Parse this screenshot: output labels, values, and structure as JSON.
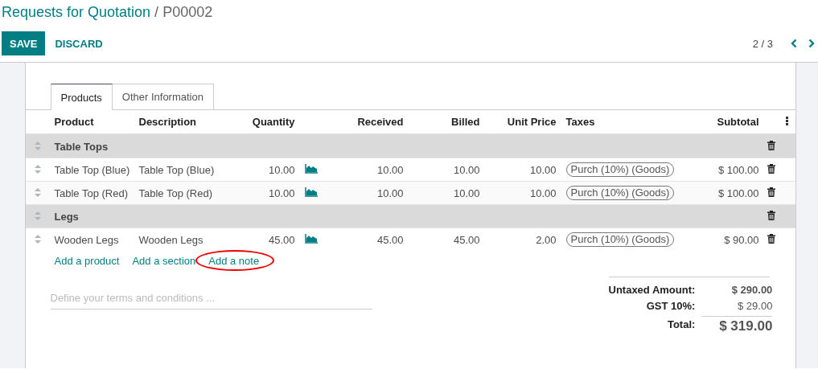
{
  "breadcrumb": {
    "parent": "Requests for Quotation",
    "separator": "/",
    "current": "P00002"
  },
  "buttons": [
    {
      "label": "SAVE",
      "kind": "primary"
    },
    {
      "label": "DISCARD",
      "kind": "link"
    }
  ],
  "pager": {
    "value": "2 / 3"
  },
  "tabs": [
    {
      "label": "Products",
      "selected": true
    },
    {
      "label": "Other Information",
      "selected": false
    }
  ],
  "table": {
    "columns": [
      "Product",
      "Description",
      "Quantity",
      "Received",
      "Billed",
      "Unit Price",
      "Taxes",
      "Subtotal"
    ],
    "rows": [
      {
        "kind": "section",
        "name": "Table Tops"
      },
      {
        "kind": "line",
        "product": "Table Top (Blue)",
        "description": "Table Top (Blue)",
        "quantity": "10.00",
        "received": "10.00",
        "billed": "10.00",
        "unit_price": "10.00",
        "taxes": "Purch (10%) (Goods)",
        "subtotal": "$ 100.00"
      },
      {
        "kind": "line",
        "product": "Table Top (Red)",
        "description": "Table Top (Red)",
        "quantity": "10.00",
        "received": "10.00",
        "billed": "10.00",
        "unit_price": "10.00",
        "taxes": "Purch (10%) (Goods)",
        "subtotal": "$ 100.00"
      },
      {
        "kind": "section",
        "name": "Legs"
      },
      {
        "kind": "line",
        "product": "Wooden Legs",
        "description": "Wooden Legs",
        "quantity": "45.00",
        "received": "45.00",
        "billed": "45.00",
        "unit_price": "2.00",
        "taxes": "Purch (10%) (Goods)",
        "subtotal": "$ 90.00"
      }
    ],
    "add_links": [
      {
        "label": "Add a product",
        "circled": false
      },
      {
        "label": "Add a section",
        "circled": false
      },
      {
        "label": "Add a note",
        "circled": true
      }
    ]
  },
  "notes": {
    "placeholder": "Define your terms and conditions ..."
  },
  "totals": [
    {
      "label": "Untaxed Amount:",
      "value": "$ 290.00",
      "kind": "untaxed"
    },
    {
      "label": "GST 10%:",
      "value": "$ 29.00",
      "kind": "tax"
    },
    {
      "label": "Total:",
      "value": "$ 319.00",
      "kind": "total"
    }
  ]
}
